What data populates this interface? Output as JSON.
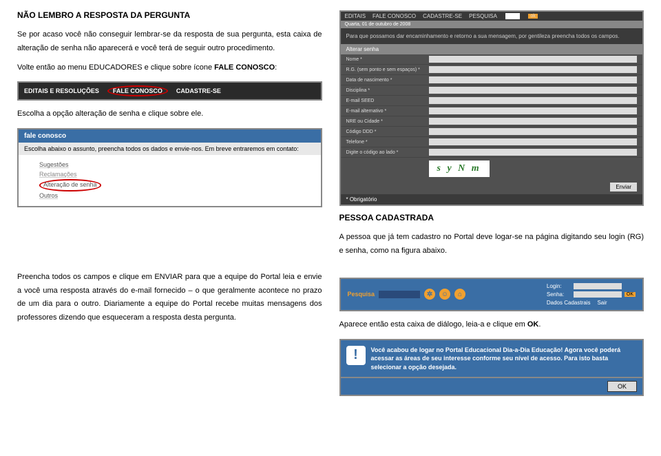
{
  "left": {
    "title": "NÃO LEMBRO A RESPOSTA DA PERGUNTA",
    "p1": "Se por acaso você não conseguir lembrar-se da resposta de sua pergunta, esta caixa de alteração de senha não aparecerá e você terá de seguir outro procedimento.",
    "p2a": "Volte então ao menu EDUCADORES e clique sobre ícone ",
    "p2b": "FALE CONOSCO",
    "p2c": ":",
    "nav": {
      "item1": "EDITAIS E RESOLUÇÕES",
      "item2": "FALE CONOSCO",
      "item3": "CADASTRE-SE"
    },
    "p3": "Escolha a opção alteração de senha e clique sobre ele.",
    "fale": {
      "header": "fale conosco",
      "sub": "Escolha abaixo o assunto, preencha todos os dados e envie-nos. Em breve entraremos em contato:",
      "opt1": "Sugestões",
      "opt2": "Reclamações",
      "opt3": "Alteração de senha",
      "opt4": "Outros"
    }
  },
  "right": {
    "topbar": {
      "editais": "EDITAIS",
      "fale": "FALE CONOSCO",
      "cad": "CADASTRE-SE",
      "pesq": "PESQUISA",
      "ok": "ok"
    },
    "date": "Quarta, 01 de outubro de 2008",
    "intro": "Para que possamos dar encaminhamento e retorno a sua mensagem, por gentileza preencha todos os campos.",
    "section": "Alterar senha",
    "fields": {
      "nome": "Nome *",
      "rg": "R.G. (sem ponto e sem espaços) *",
      "data": "Data de nascimento *",
      "disc": "Disciplina *",
      "email1": "E-mail SEED",
      "email2": "E-mail alternativo *",
      "nre": "NRE ou Cidade *",
      "ddd": "Código DDD *",
      "tel": "Telefone *",
      "cod": "Digite o código ao lado *"
    },
    "captcha": "s y N m",
    "enviar": "Enviar",
    "oblig": "* Obrigatório",
    "pessoa_title": "PESSOA CADASTRADA",
    "pessoa_text": "A pessoa que já tem cadastro no Portal deve logar-se na página digitando seu login (RG) e senha, como na figura abaixo."
  },
  "lower_left": {
    "text": "Preencha todos os campos e clique em ENVIAR para que a equipe do Portal leia e envie a você uma resposta através do e-mail fornecido – o que geralmente acontece no prazo de um dia para o outro. Diariamente a equipe do Portal recebe muitas mensagens dos professores dizendo que esqueceram a resposta desta pergunta."
  },
  "lower_right": {
    "login": {
      "pesq": "Pesquisa",
      "login_lbl": "Login:",
      "senha_lbl": "Senha:",
      "ok": "OK",
      "dados": "Dados Cadastrais",
      "sair": "Sair"
    },
    "aparece_a": "Aparece então esta caixa de diálogo, leia-a e clique em ",
    "aparece_b": "OK",
    "aparece_c": ".",
    "dialog": {
      "text": "Você acabou de logar no Portal Educacional Dia-a-Dia Educação! Agora você poderá acessar as áreas de seu interesse conforme seu nível de acesso. Para isto basta selecionar a opção desejada.",
      "ok": "OK"
    }
  }
}
